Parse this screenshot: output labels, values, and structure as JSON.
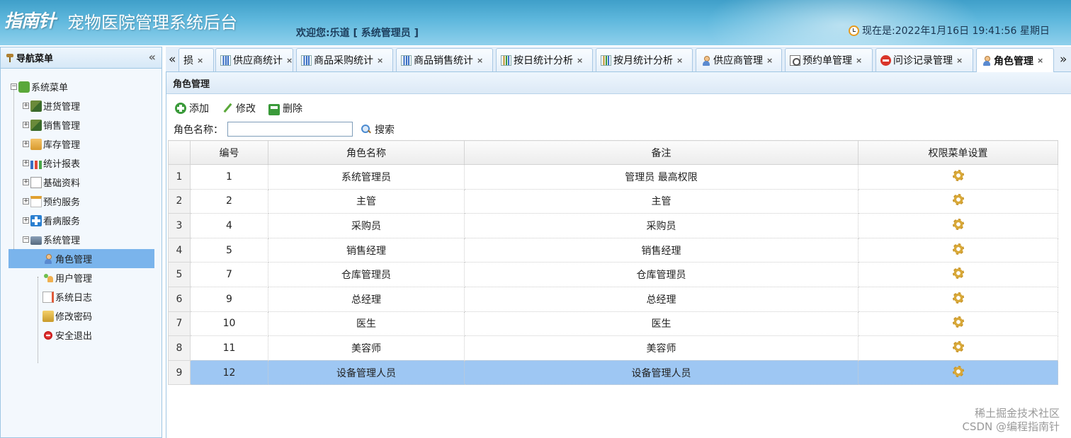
{
  "header": {
    "logo_text": "指南针",
    "title": "宠物医院管理系统后台",
    "welcome": "欢迎您:乐道 [ 系统管理员 ]",
    "datetime": "现在是:2022年1月16日 19:41:56 星期日"
  },
  "nav": {
    "title": "导航菜单",
    "collapse": "«",
    "root": "系统菜单",
    "groups": [
      "进货管理",
      "销售管理",
      "库存管理",
      "统计报表",
      "基础资料",
      "预约服务",
      "看病服务",
      "系统管理"
    ],
    "system_items": [
      "角色管理",
      "用户管理",
      "系统日志",
      "修改密码",
      "安全退出"
    ]
  },
  "tabs": {
    "left_arrow": "«",
    "right_arrow": "»",
    "items": [
      {
        "label": "损"
      },
      {
        "label": "供应商统计"
      },
      {
        "label": "商品采购统计"
      },
      {
        "label": "商品销售统计"
      },
      {
        "label": "按日统计分析"
      },
      {
        "label": "按月统计分析"
      },
      {
        "label": "供应商管理"
      },
      {
        "label": "预约单管理"
      },
      {
        "label": "问诊记录管理"
      },
      {
        "label": "角色管理"
      }
    ],
    "close": "×"
  },
  "panel": {
    "title": "角色管理",
    "toolbar": {
      "add": "添加",
      "edit": "修改",
      "delete": "删除"
    },
    "search": {
      "label": "角色名称：",
      "value": "",
      "button": "搜索"
    }
  },
  "grid": {
    "columns": [
      "编号",
      "角色名称",
      "备注",
      "权限菜单设置"
    ],
    "rows": [
      {
        "n": "1",
        "id": "1",
        "name": "系统管理员",
        "remark": "管理员 最高权限"
      },
      {
        "n": "2",
        "id": "2",
        "name": "主管",
        "remark": "主管"
      },
      {
        "n": "3",
        "id": "4",
        "name": "采购员",
        "remark": "采购员"
      },
      {
        "n": "4",
        "id": "5",
        "name": "销售经理",
        "remark": "销售经理"
      },
      {
        "n": "5",
        "id": "7",
        "name": "仓库管理员",
        "remark": "仓库管理员"
      },
      {
        "n": "6",
        "id": "9",
        "name": "总经理",
        "remark": "总经理"
      },
      {
        "n": "7",
        "id": "10",
        "name": "医生",
        "remark": "医生"
      },
      {
        "n": "8",
        "id": "11",
        "name": "美容师",
        "remark": "美容师"
      },
      {
        "n": "9",
        "id": "12",
        "name": "设备管理人员",
        "remark": "设备管理人员"
      }
    ],
    "selected_row": 9
  },
  "watermark": {
    "line1": "稀土掘金技术社区",
    "line2": "CSDN @编程指南针"
  }
}
